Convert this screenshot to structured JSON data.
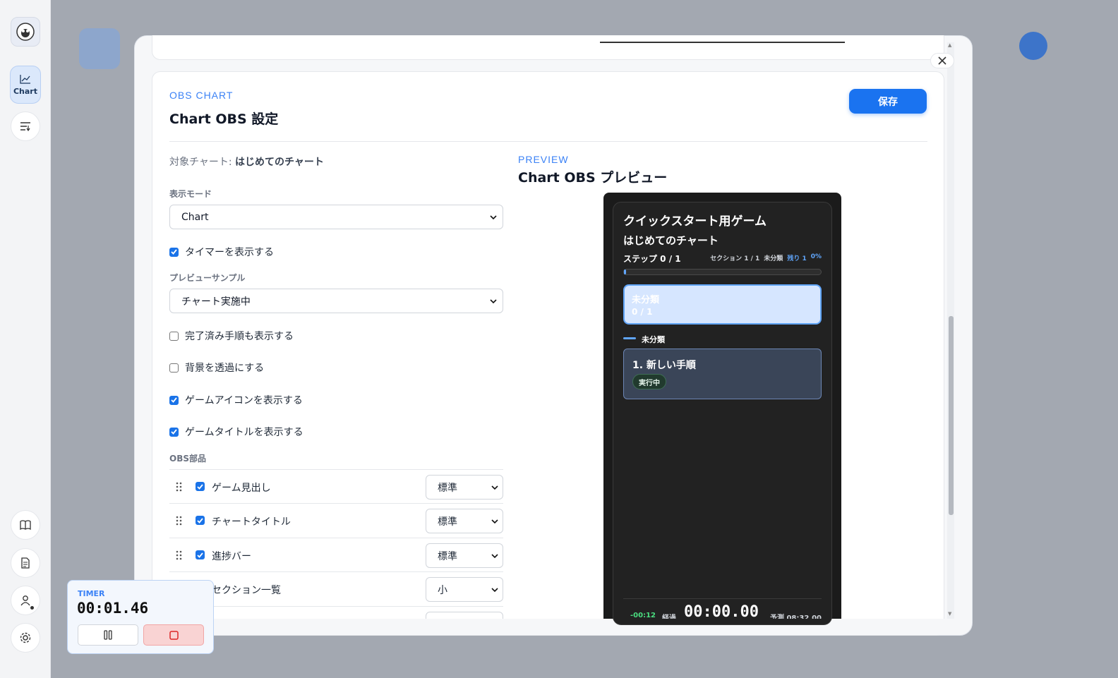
{
  "rail": {
    "chart_label": "Chart",
    "items": [
      "chart",
      "list",
      "book",
      "doc",
      "user",
      "settings"
    ]
  },
  "modal": {
    "eyebrow": "OBS CHART",
    "title": "Chart OBS 設定",
    "save_label": "保存",
    "target_prefix": "対象チャート:",
    "target_name": "はじめてのチャート",
    "display_mode_label": "表示モード",
    "display_mode_value": "Chart",
    "preview_sample_label": "プレビューサンプル",
    "preview_sample_value": "チャート実施中",
    "checkboxes": [
      {
        "label": "タイマーを表示する",
        "checked": true
      },
      {
        "label": "完了済み手順も表示する",
        "checked": false
      },
      {
        "label": "背景を透過にする",
        "checked": false
      },
      {
        "label": "ゲームアイコンを表示する",
        "checked": true
      },
      {
        "label": "ゲームタイトルを表示する",
        "checked": true
      }
    ],
    "parts_label": "OBS部品",
    "parts": [
      {
        "label": "ゲーム見出し",
        "checked": true,
        "size": "標準"
      },
      {
        "label": "チャートタイトル",
        "checked": true,
        "size": "標準"
      },
      {
        "label": "進捗バー",
        "checked": true,
        "size": "標準"
      },
      {
        "label": "セクション一覧",
        "checked": true,
        "size": "小"
      }
    ]
  },
  "preview": {
    "eyebrow": "PREVIEW",
    "title": "Chart OBS プレビュー",
    "game_title": "クイックスタート用ゲーム",
    "chart_title": "はじめてのチャート",
    "step_progress": "ステップ 0 / 1",
    "section_progress": "セクション 1 / 1",
    "section_name_small": "未分類",
    "remaining": "残り 1",
    "percent": "0%",
    "progress_fraction": 0.01,
    "section_card_title": "未分類",
    "section_card_count": "0 / 1",
    "group_header": "未分類",
    "step_title": "1. 新しい手順",
    "step_badge": "実行中",
    "footer_delta": "-00:12",
    "footer_elapsed_label": "経過",
    "footer_time": "00:00.00",
    "footer_forecast": "予測 08:32.00"
  },
  "timer": {
    "label": "TIMER",
    "value": "00:01.46"
  },
  "colors": {
    "accent": "#1a73f0",
    "preview_bg": "#222222",
    "section_card": "#d6e6ff",
    "step_card": "#3a4558",
    "stop_button": "#f9d3d3"
  }
}
